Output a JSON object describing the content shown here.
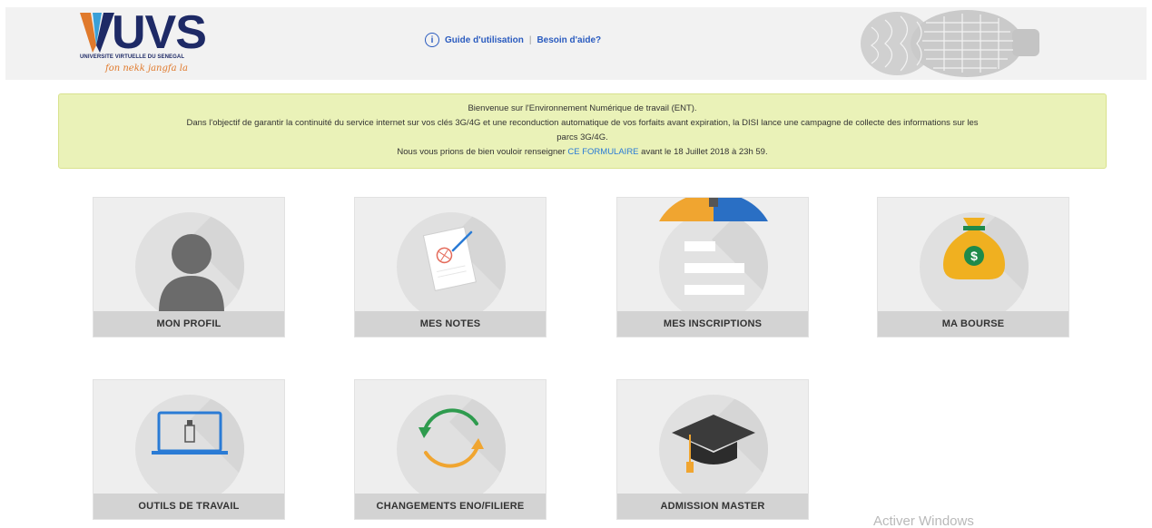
{
  "header": {
    "logo_text": "UVS",
    "logo_subtitle": "UNIVERSITE VIRTUELLE DU SENEGAL",
    "logo_slogan": "fon nekk jangfa la",
    "help_link_guide": "Guide d'utilisation",
    "help_separator": "|",
    "help_link_aide": "Besoin d'aide?"
  },
  "notice": {
    "line1": "Bienvenue sur l'Environnement Numérique de travail (ENT).",
    "line2": "Dans l'objectif de garantir la continuité du service internet sur vos clés 3G/4G et une reconduction automatique de vos forfaits avant expiration, la DISI lance une campagne de collecte des informations sur les",
    "line3": "parcs 3G/4G.",
    "line4_before": "Nous vous prions de bien vouloir renseigner ",
    "line4_link": "CE FORMULAIRE",
    "line4_after": " avant le 18 Juillet 2018 à 23h 59."
  },
  "tiles": [
    {
      "label": "MON PROFIL",
      "icon": "profile-icon"
    },
    {
      "label": "MES NOTES",
      "icon": "grades-icon"
    },
    {
      "label": "MES INSCRIPTIONS",
      "icon": "registration-icon"
    },
    {
      "label": "MA BOURSE",
      "icon": "money-bag-icon"
    },
    {
      "label": "OUTILS DE TRAVAIL",
      "icon": "laptop-usb-icon"
    },
    {
      "label": "CHANGEMENTS ENO/FILIERE",
      "icon": "refresh-arrows-icon"
    },
    {
      "label": "ADMISSION MASTER",
      "icon": "graduation-cap-icon"
    }
  ],
  "watermark": "Activer Windows",
  "colors": {
    "brand_navy": "#1e2a66",
    "brand_orange": "#e07a2c",
    "link_blue": "#2a5bbf",
    "notice_bg": "#eaf2b8",
    "tile_bg": "#eeeeee",
    "tile_label_bg": "#d3d3d3"
  }
}
